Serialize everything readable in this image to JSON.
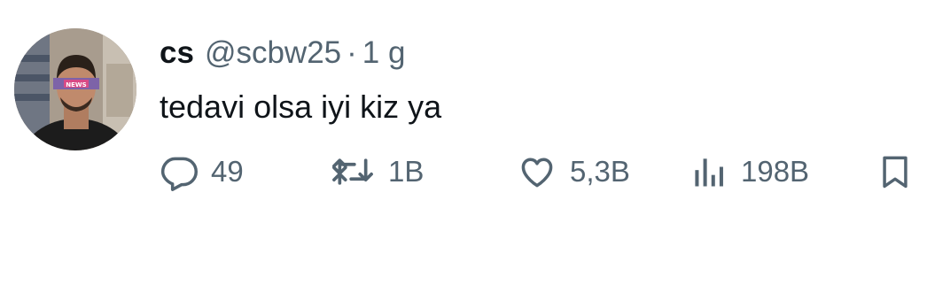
{
  "tweet": {
    "display_name": "cs",
    "handle": "@scbw25",
    "separator": "·",
    "time": "1 g",
    "text": "tedavi olsa iyi kiz ya",
    "avatar_badge_text": "NEWS"
  },
  "actions": {
    "reply": {
      "icon": "reply-bubble-icon",
      "count": "49"
    },
    "retweet": {
      "icon": "retweet-arrows-icon",
      "count": "1B"
    },
    "like": {
      "icon": "heart-outline-icon",
      "count": "5,3B"
    },
    "views": {
      "icon": "bar-chart-views-icon",
      "count": "198B"
    },
    "bookmark": {
      "icon": "bookmark-outline-icon"
    }
  },
  "colors": {
    "text_primary": "#0f1419",
    "text_secondary": "#536471",
    "background": "#ffffff"
  }
}
